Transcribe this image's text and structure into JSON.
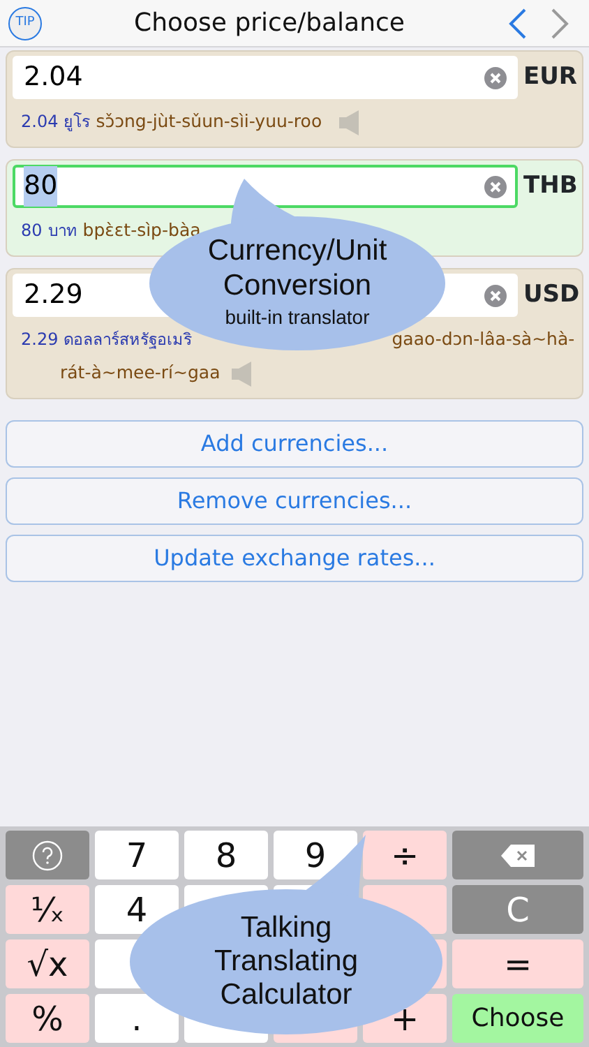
{
  "header": {
    "tip": "TIP",
    "title": "Choose price/balance",
    "back_enabled": true,
    "forward_enabled": false
  },
  "currencies": [
    {
      "value": "2.04",
      "code": "EUR",
      "selected": false,
      "amount": "2.04",
      "thai": "ยูโร",
      "translit": [
        "sɔ̌ɔng-jùt-sǔun-sìi-yuu-roo"
      ],
      "speaker": true
    },
    {
      "value": "80",
      "code": "THB",
      "selected": true,
      "amount": "80",
      "thai": "บาท",
      "translit": [
        "bpɛ̀ɛt-sìp-bàa"
      ],
      "speaker": false
    },
    {
      "value": "2.29",
      "code": "USD",
      "selected": false,
      "amount": "2.29",
      "thai": "ดอลลาร์สหรัฐอเมริ",
      "translit": [
        "gaao-dɔn-lâa-sà~hà-",
        "rát-à~mee-rí~gaa"
      ],
      "speaker": true
    }
  ],
  "actions": [
    "Add currencies...",
    "Remove currencies...",
    "Update exchange rates..."
  ],
  "keypad": [
    {
      "kind": "help"
    },
    {
      "kind": "digit",
      "label": "7"
    },
    {
      "kind": "digit",
      "label": "8"
    },
    {
      "kind": "digit",
      "label": "9"
    },
    {
      "kind": "op",
      "label": "÷"
    },
    {
      "kind": "backspace"
    },
    {
      "kind": "op",
      "label": "¹⁄ₓ"
    },
    {
      "kind": "digit",
      "label": "4"
    },
    {
      "kind": "digit"
    },
    {
      "kind": "digit"
    },
    {
      "kind": "op"
    },
    {
      "kind": "func",
      "label": "C"
    },
    {
      "kind": "op",
      "label": "√x"
    },
    {
      "kind": "digit"
    },
    {
      "kind": "covered"
    },
    {
      "kind": "covered"
    },
    {
      "kind": "op"
    },
    {
      "kind": "op",
      "label": "="
    },
    {
      "kind": "op",
      "label": "%"
    },
    {
      "kind": "digit",
      "label": "."
    },
    {
      "kind": "digit"
    },
    {
      "kind": "op"
    },
    {
      "kind": "op",
      "label": "+"
    },
    {
      "kind": "choose",
      "label": "Choose"
    }
  ],
  "bubbles": [
    {
      "lines": [
        "Currency/Unit",
        "Conversion"
      ],
      "subtitle": "built-in translator"
    },
    {
      "lines": [
        "Talking",
        "Translating",
        "Calculator"
      ]
    }
  ]
}
